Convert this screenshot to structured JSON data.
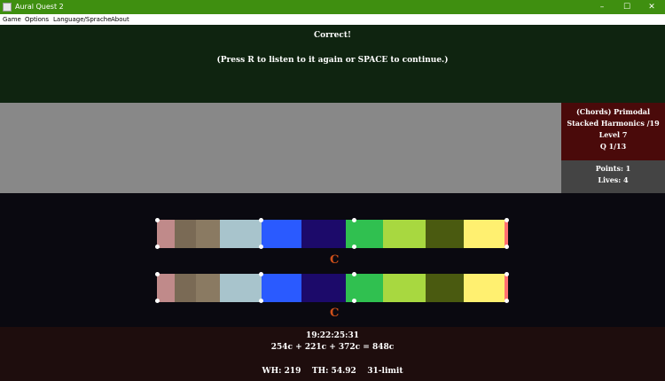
{
  "window": {
    "title": "Aural Quest 2",
    "minimize": "–",
    "maximize": "☐",
    "close": "✕"
  },
  "menu": [
    "Game",
    "Options",
    "Language/Sprache",
    "About"
  ],
  "message": {
    "line1": "Correct!",
    "line2": "(Press R to listen to it again or SPACE to continue.)"
  },
  "info": {
    "line1": "(Chords) Primodal",
    "line2": "Stacked Harmonics /19",
    "line3": "Level 7",
    "line4": "Q 1/13"
  },
  "score": {
    "points": "Points: 1",
    "lives": "Lives: 4"
  },
  "bars": [
    {
      "note": "C"
    },
    {
      "note": "C"
    }
  ],
  "colors": {
    "segments": [
      "#c08a8a",
      "#7a6a55",
      "#8a7a62",
      "#a8c4cc",
      "#2a5aff",
      "#1c0a6a",
      "#30c050",
      "#a8d840",
      "#4a5a10",
      "#fff070",
      "#ff7070"
    ]
  },
  "bottom": {
    "ratio": "19:22:25:31",
    "cents": "254c + 221c + 372c = 848c",
    "stats": "WH: 219    TH: 54.92    31-limit"
  }
}
